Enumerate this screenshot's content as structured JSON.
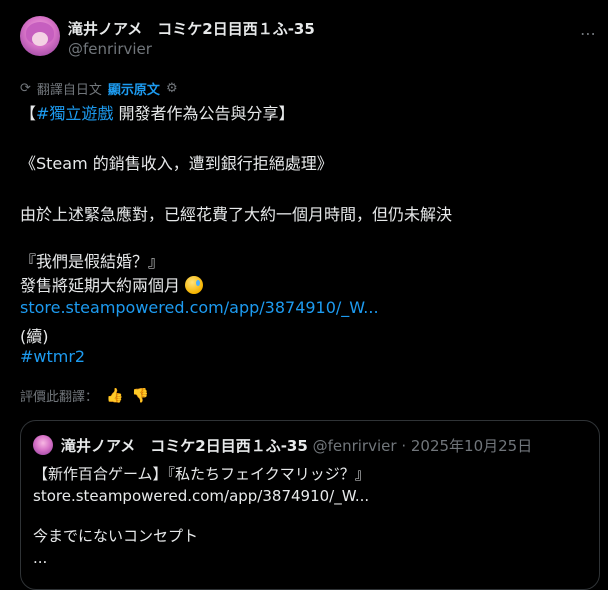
{
  "author": {
    "display_name": "滝井ノアメ　コミケ2日目西１ふ-35",
    "handle": "@fenrirvier"
  },
  "more_icon": "⋯",
  "translate": {
    "label": "翻譯自日文",
    "show_original": "顯示原文",
    "icon_translate": "translate-icon",
    "icon_settings": "gear-icon"
  },
  "body": {
    "l1_open": "【",
    "l1_hashtag": "#獨立遊戲",
    "l1_rest": " 開發者作為公告與分享】",
    "l2": "《Steam 的銷售收入，遭到銀行拒絕處理》",
    "l3": "由於上述緊急應對，已經花費了大約一個月時間，但仍未解決",
    "l4": "『我們是假結婚？』",
    "l5": "發售將延期大約兩個月",
    "link": "store.steampowered.com/app/3874910/_W...",
    "cont": "(續)",
    "hashtag2": "#wtmr2"
  },
  "rate": {
    "label": "評價此翻譯："
  },
  "quote": {
    "name": "滝井ノアメ　コミケ2日目西１ふ-35",
    "handle": "@fenrirvier",
    "date": " · 2025年10月25日",
    "l1": "【新作百合ゲーム】『私たちフェイクマリッジ？』",
    "l2": "store.steampowered.com/app/3874910/_W...",
    "l3": "今までにないコンセプト",
    "l4": "..."
  },
  "colors": {
    "accent": "#1d9bf0",
    "muted": "#71767b",
    "text": "#e7e9ea",
    "bg": "#000000"
  }
}
